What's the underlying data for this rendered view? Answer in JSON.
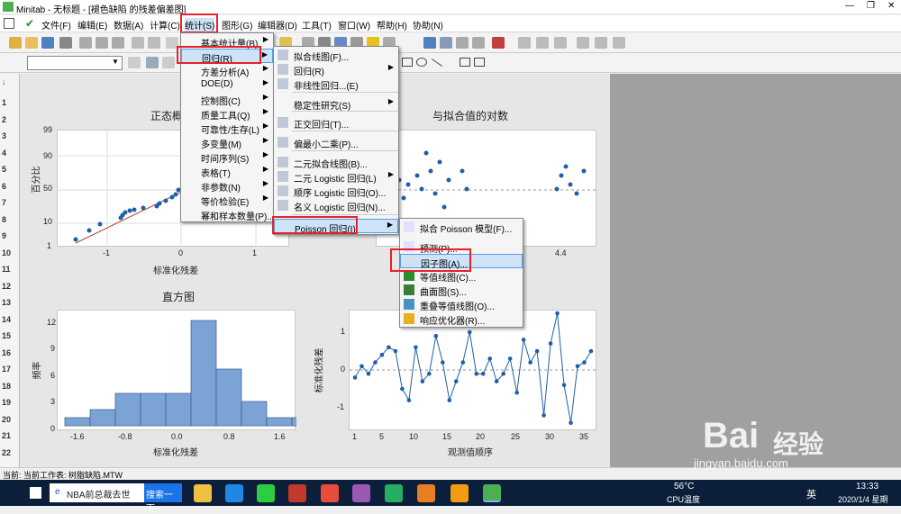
{
  "window": {
    "app_title": "Minitab - 无标题 - [褪色缺陷 的残差偏差图]",
    "buttons": {
      "minimize": "—",
      "maximize": "❐",
      "close": "✕"
    }
  },
  "menubar": {
    "items": [
      "文件(F)",
      "编辑(E)",
      "数据(A)",
      "计算(C)",
      "统计(S)",
      "图形(G)",
      "编辑器(D)",
      "工具(T)",
      "窗口(W)",
      "帮助(H)",
      "协助(N)"
    ]
  },
  "stats_menu": {
    "items": [
      "基本统计量(B)",
      "回归(R)",
      "方差分析(A)",
      "DOE(D)",
      "控制图(C)",
      "质量工具(Q)",
      "可靠性/生存(L)",
      "多变量(M)",
      "时间序列(S)",
      "表格(T)",
      "非参数(N)",
      "等价检验(E)",
      "幂和样本数量(P)..."
    ]
  },
  "regression_menu": {
    "items": [
      "拟合线图(F)...",
      "回归(R)",
      "非线性回归...(E)",
      "稳定性研究(S)",
      "正交回归(T)...",
      "偏最小二乘(P)...",
      "二元拟合线图(B)...",
      "二元 Logistic 回归(L)",
      "顺序 Logistic 回归(O)...",
      "名义 Logistic 回归(N)...",
      "Poisson 回归(I)"
    ]
  },
  "poisson_menu": {
    "items": [
      "拟合 Poisson 模型(F)...",
      "预测(P)...",
      "因子图(A)...",
      "等值线图(C)...",
      "曲面图(S)...",
      "重叠等值线图(O)...",
      "响应优化器(R)..."
    ]
  },
  "rows": [
    "1",
    "2",
    "3",
    "4",
    "5",
    "6",
    "7",
    "8",
    "9",
    "10",
    "11",
    "12",
    "13",
    "14",
    "15",
    "16",
    "17",
    "18",
    "19",
    "20",
    "21",
    "22"
  ],
  "graphs": {
    "prob": {
      "title": "正态概率图",
      "ylabel": "百分比",
      "xlabel": "标准化残差",
      "yticks": [
        "99",
        "90",
        "50",
        "10",
        "1"
      ],
      "xticks": [
        "-1",
        "0",
        "1"
      ]
    },
    "fits": {
      "title": "与拟合值的对数",
      "xticks": [
        "4.4"
      ]
    },
    "hist": {
      "title": "直方图",
      "ylabel": "频率",
      "xlabel": "标准化残差",
      "yticks": [
        "12",
        "9",
        "6",
        "3",
        "0"
      ],
      "xticks": [
        "-1.6",
        "-0.8",
        "0.0",
        "0.8",
        "1.6"
      ]
    },
    "order": {
      "ylabel": "标准化残差",
      "xlabel": "观测值顺序",
      "yticks": [
        "1",
        "0",
        "-1"
      ],
      "xticks": [
        "1",
        "5",
        "10",
        "15",
        "20",
        "25",
        "30",
        "35"
      ]
    }
  },
  "chart_data": [
    {
      "type": "bar",
      "title": "直方图",
      "xlabel": "标准化残差",
      "ylabel": "频率",
      "ylim": [
        0,
        14
      ],
      "categories": [
        "-1.8",
        "-1.6",
        "-1.2",
        "-0.8",
        "-0.4",
        "0.0",
        "0.4",
        "0.8",
        "1.2",
        "1.6"
      ],
      "values": [
        1,
        2,
        4,
        4,
        4,
        13,
        7,
        3,
        1,
        1
      ]
    },
    {
      "type": "line",
      "title": "",
      "xlabel": "观测值顺序",
      "ylabel": "标准化残差",
      "ylim": [
        -1.5,
        1.7
      ],
      "x": [
        1,
        2,
        3,
        4,
        5,
        6,
        7,
        8,
        9,
        10,
        11,
        12,
        13,
        14,
        15,
        16,
        17,
        18,
        19,
        20,
        21,
        22,
        23,
        24,
        25,
        26,
        27,
        28,
        29,
        30,
        31,
        32,
        33,
        34,
        35,
        36
      ],
      "y": [
        -0.2,
        0.1,
        -0.1,
        0.2,
        0.4,
        0.6,
        0.5,
        -0.5,
        -0.8,
        0.6,
        -0.3,
        -0.1,
        0.9,
        0.2,
        -0.8,
        -0.3,
        0.2,
        1.0,
        -0.1,
        -0.1,
        0.3,
        -0.3,
        -0.1,
        0.3,
        -0.6,
        0.8,
        0.2,
        0.5,
        -1.2,
        0.7,
        1.5,
        -0.4,
        -1.4,
        0.1,
        0.2,
        0.5
      ]
    }
  ],
  "statusbar": {
    "text": "当前: 当前工作表: 树脂缺陷.MTW"
  },
  "taskbar": {
    "search_box": "NBA前总裁去世",
    "search_button": "搜索一下",
    "weather": "56°C",
    "weather_sub": "CPU温度",
    "ime": "英",
    "time": "13:33",
    "date": "2020/1/4 星期"
  },
  "watermark": {
    "brand": "Bai",
    "brand2": "经验",
    "url": "jingyan.baidu.com"
  },
  "colors": {
    "highlight_red": "#e8212a",
    "series_blue": "#1f5fa8",
    "bar_fill": "#7ba3d6"
  }
}
